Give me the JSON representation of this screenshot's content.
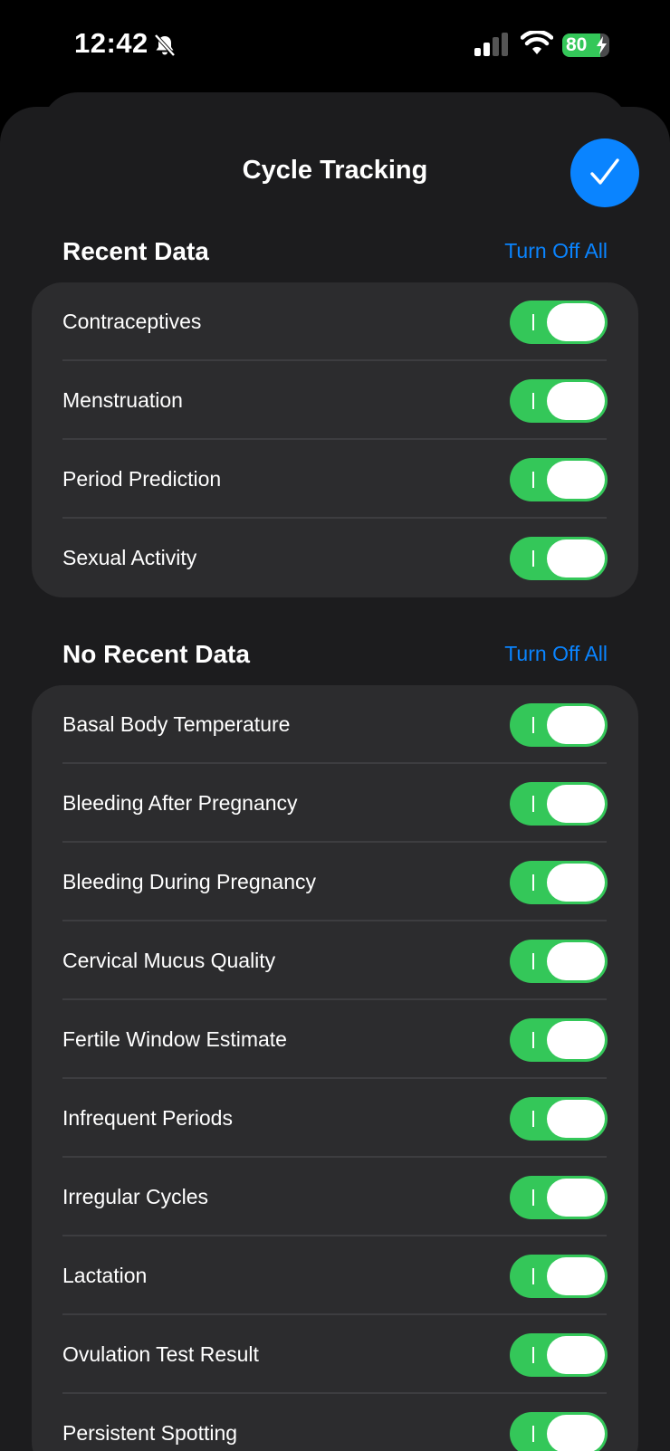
{
  "status_bar": {
    "time": "12:42",
    "battery_level": "80",
    "battery_percent": 80,
    "icons": [
      "bell-slash-icon",
      "cellular-signal-icon",
      "wifi-icon",
      "battery-charging-icon"
    ]
  },
  "sheet": {
    "title": "Cycle Tracking",
    "done_icon": "checkmark-icon"
  },
  "colors": {
    "accent": "#0a84ff",
    "toggle_on": "#34c759",
    "background": "#1c1c1e",
    "group_background": "#2c2c2e"
  },
  "sections": [
    {
      "title": "Recent Data",
      "action_label": "Turn Off All",
      "items": [
        {
          "label": "Contraceptives",
          "on": true
        },
        {
          "label": "Menstruation",
          "on": true
        },
        {
          "label": "Period Prediction",
          "on": true
        },
        {
          "label": "Sexual Activity",
          "on": true
        }
      ]
    },
    {
      "title": "No Recent Data",
      "action_label": "Turn Off All",
      "items": [
        {
          "label": "Basal Body Temperature",
          "on": true
        },
        {
          "label": "Bleeding After Pregnancy",
          "on": true
        },
        {
          "label": "Bleeding During Pregnancy",
          "on": true
        },
        {
          "label": "Cervical Mucus Quality",
          "on": true
        },
        {
          "label": "Fertile Window Estimate",
          "on": true
        },
        {
          "label": "Infrequent Periods",
          "on": true
        },
        {
          "label": "Irregular Cycles",
          "on": true
        },
        {
          "label": "Lactation",
          "on": true
        },
        {
          "label": "Ovulation Test Result",
          "on": true
        },
        {
          "label": "Persistent Spotting",
          "on": true
        }
      ]
    }
  ]
}
